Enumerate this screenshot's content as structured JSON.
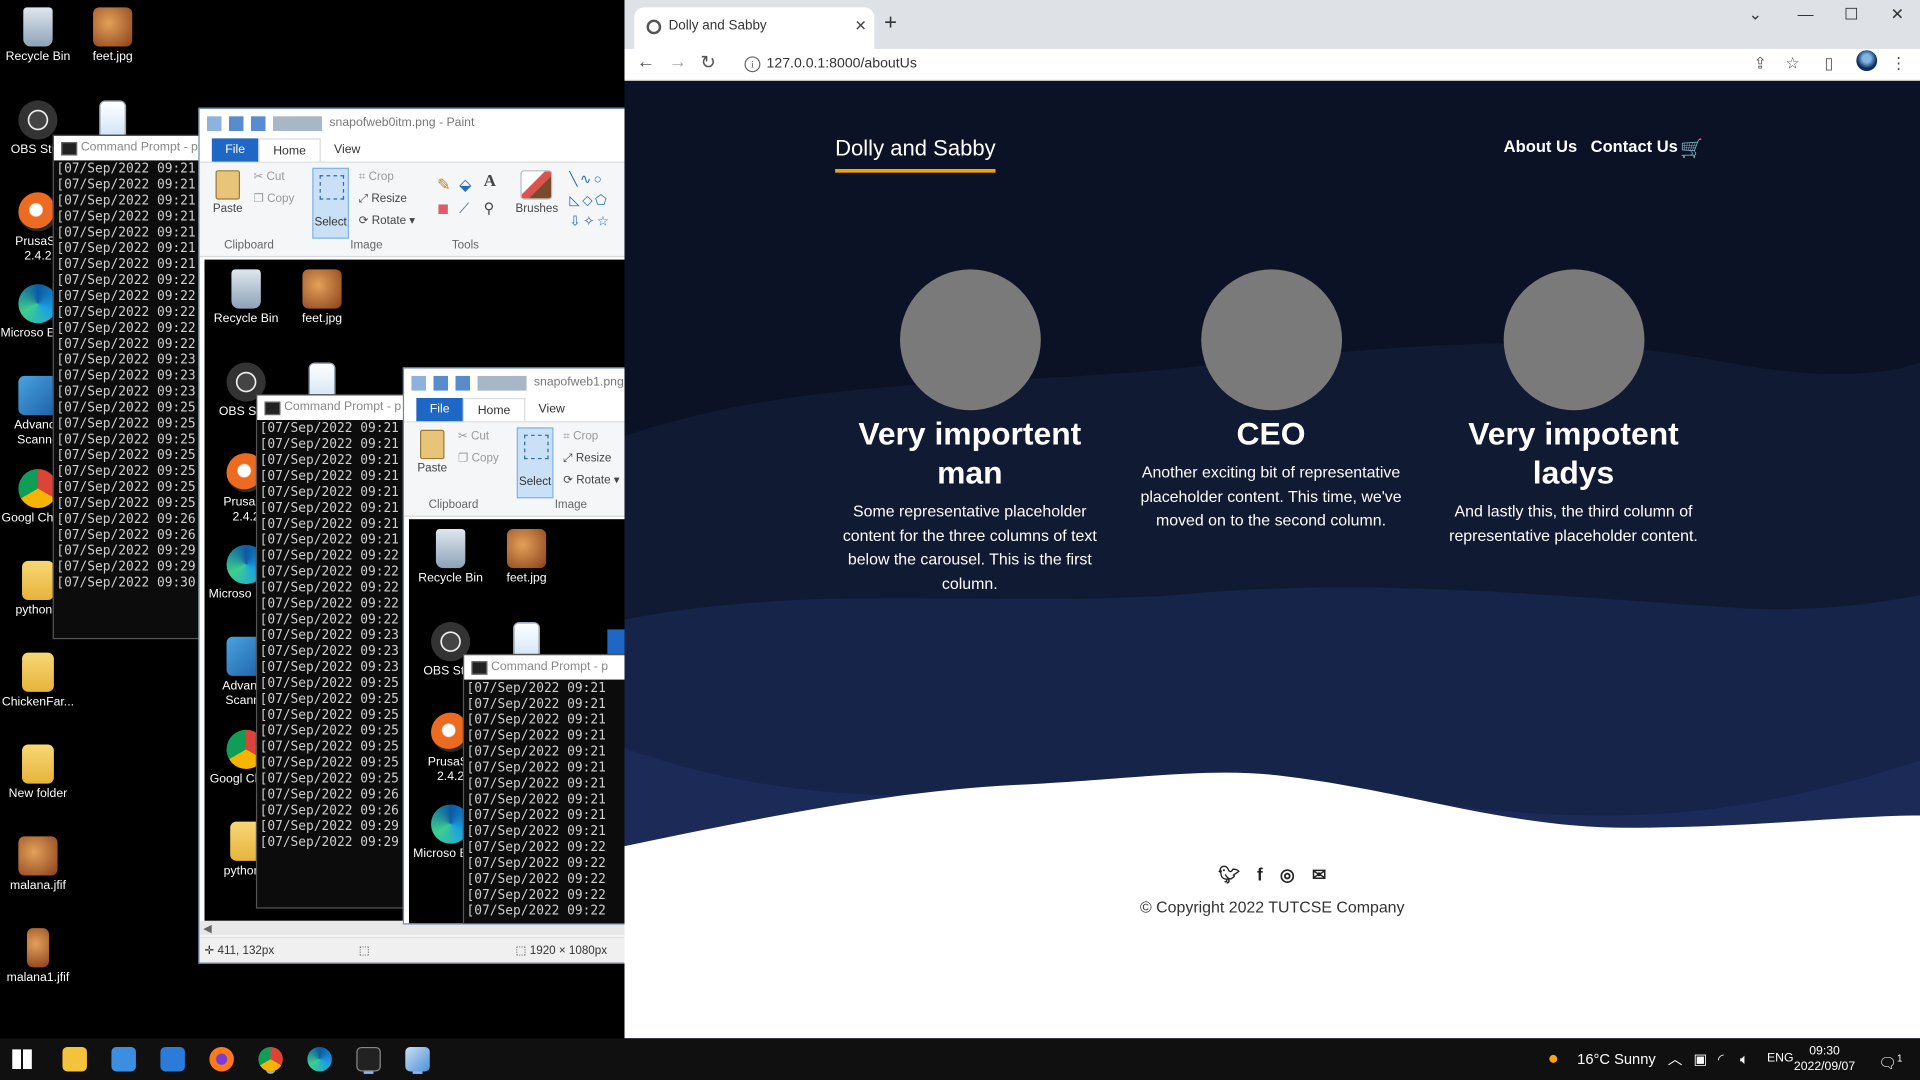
{
  "desktop": {
    "icons_col1": [
      {
        "name": "recycle-bin",
        "label": "Recycle Bin"
      },
      {
        "name": "obs-studio",
        "label": "OBS Stud"
      },
      {
        "name": "prusaslicer",
        "label": "PrusaSli 2.4.2"
      },
      {
        "name": "microsoft-edge",
        "label": "Microso Edge"
      },
      {
        "name": "advanced-scanner",
        "label": "Advance Scanne"
      },
      {
        "name": "google-chrome",
        "label": "Googl Chrom"
      },
      {
        "name": "python-folder",
        "label": "pythonE"
      },
      {
        "name": "chicken-folder",
        "label": "ChickenFar..."
      },
      {
        "name": "new-folder",
        "label": "New folder"
      },
      {
        "name": "malana-jfif",
        "label": "malana.jfif"
      },
      {
        "name": "malana1-jfif",
        "label": "malana1.jfif"
      }
    ],
    "feet_label": "feet.jpg"
  },
  "cmd": {
    "title": "Command Prompt - p",
    "lines_a": [
      "[07/Sep/2022 09:21",
      "[07/Sep/2022 09:21",
      "[07/Sep/2022 09:21",
      "[07/Sep/2022 09:21",
      "[07/Sep/2022 09:21",
      "[07/Sep/2022 09:21",
      "[07/Sep/2022 09:21",
      "[07/Sep/2022 09:22",
      "[07/Sep/2022 09:22",
      "[07/Sep/2022 09:22",
      "[07/Sep/2022 09:22",
      "[07/Sep/2022 09:22",
      "[07/Sep/2022 09:23",
      "[07/Sep/2022 09:23",
      "[07/Sep/2022 09:23",
      "[07/Sep/2022 09:25",
      "[07/Sep/2022 09:25",
      "[07/Sep/2022 09:25",
      "[07/Sep/2022 09:25",
      "[07/Sep/2022 09:25",
      "[07/Sep/2022 09:25",
      "[07/Sep/2022 09:25",
      "[07/Sep/2022 09:26",
      "[07/Sep/2022 09:26",
      "[07/Sep/2022 09:29",
      "[07/Sep/2022 09:29",
      "[07/Sep/2022 09:30"
    ],
    "lines_b": [
      "[07/Sep/2022 09:21",
      "[07/Sep/2022 09:21",
      "[07/Sep/2022 09:21",
      "[07/Sep/2022 09:21",
      "[07/Sep/2022 09:21",
      "[07/Sep/2022 09:21",
      "[07/Sep/2022 09:21",
      "[07/Sep/2022 09:21",
      "[07/Sep/2022 09:22",
      "[07/Sep/2022 09:22",
      "[07/Sep/2022 09:22",
      "[07/Sep/2022 09:22",
      "[07/Sep/2022 09:22",
      "[07/Sep/2022 09:23",
      "[07/Sep/2022 09:23",
      "[07/Sep/2022 09:23",
      "[07/Sep/2022 09:25",
      "[07/Sep/2022 09:25",
      "[07/Sep/2022 09:25",
      "[07/Sep/2022 09:25",
      "[07/Sep/2022 09:25",
      "[07/Sep/2022 09:25",
      "[07/Sep/2022 09:25",
      "[07/Sep/2022 09:26",
      "[07/Sep/2022 09:26",
      "[07/Sep/2022 09:29",
      "[07/Sep/2022 09:29"
    ],
    "lines_c": [
      "[07/Sep/2022 09:21",
      "[07/Sep/2022 09:21",
      "[07/Sep/2022 09:21",
      "[07/Sep/2022 09:21",
      "[07/Sep/2022 09:21",
      "[07/Sep/2022 09:21",
      "[07/Sep/2022 09:21",
      "[07/Sep/2022 09:21",
      "[07/Sep/2022 09:21",
      "[07/Sep/2022 09:21",
      "[07/Sep/2022 09:22",
      "[07/Sep/2022 09:22",
      "[07/Sep/2022 09:22",
      "[07/Sep/2022 09:22",
      "[07/Sep/2022 09:22"
    ]
  },
  "paint1": {
    "title": "snapofweb0itm.png - Paint",
    "tabs": {
      "file": "File",
      "home": "Home",
      "view": "View"
    },
    "paste": "Paste",
    "cut": "Cut",
    "copy": "Copy",
    "select": "Select",
    "crop": "Crop",
    "resize": "Resize",
    "rotate": "Rotate",
    "brushes": "Brushes",
    "groups": {
      "clipboard": "Clipboard",
      "image": "Image",
      "tools": "Tools"
    },
    "status_pos": "411, 132px",
    "status_size": "1920 × 1080px"
  },
  "paint2": {
    "title": "snapofweb1.png"
  },
  "browser": {
    "tab_title": "Dolly and Sabby",
    "url": "127.0.0.1:8000/aboutUs"
  },
  "site": {
    "brand": "Dolly and Sabby",
    "nav": {
      "about": "About Us",
      "contact": "Contact Us"
    },
    "columns": [
      {
        "title": "Very importent man",
        "text": "Some representative placeholder content for the three columns of text below the carousel. This is the first column."
      },
      {
        "title": "CEO",
        "text": "Another exciting bit of representative placeholder content. This time, we've moved on to the second column."
      },
      {
        "title": "Very impotent ladys",
        "text": "And lastly this, the third column of representative placeholder content."
      }
    ],
    "social_icons": [
      "twitter-icon",
      "facebook-icon",
      "instagram-icon",
      "envelope-icon"
    ],
    "copyright": "© Copyright 2022 TUTCSE Company"
  },
  "taskbar": {
    "weather": "16°C  Sunny",
    "lang": "ENG",
    "time": "09:30",
    "date": "2022/09/07",
    "notifications": "1"
  }
}
